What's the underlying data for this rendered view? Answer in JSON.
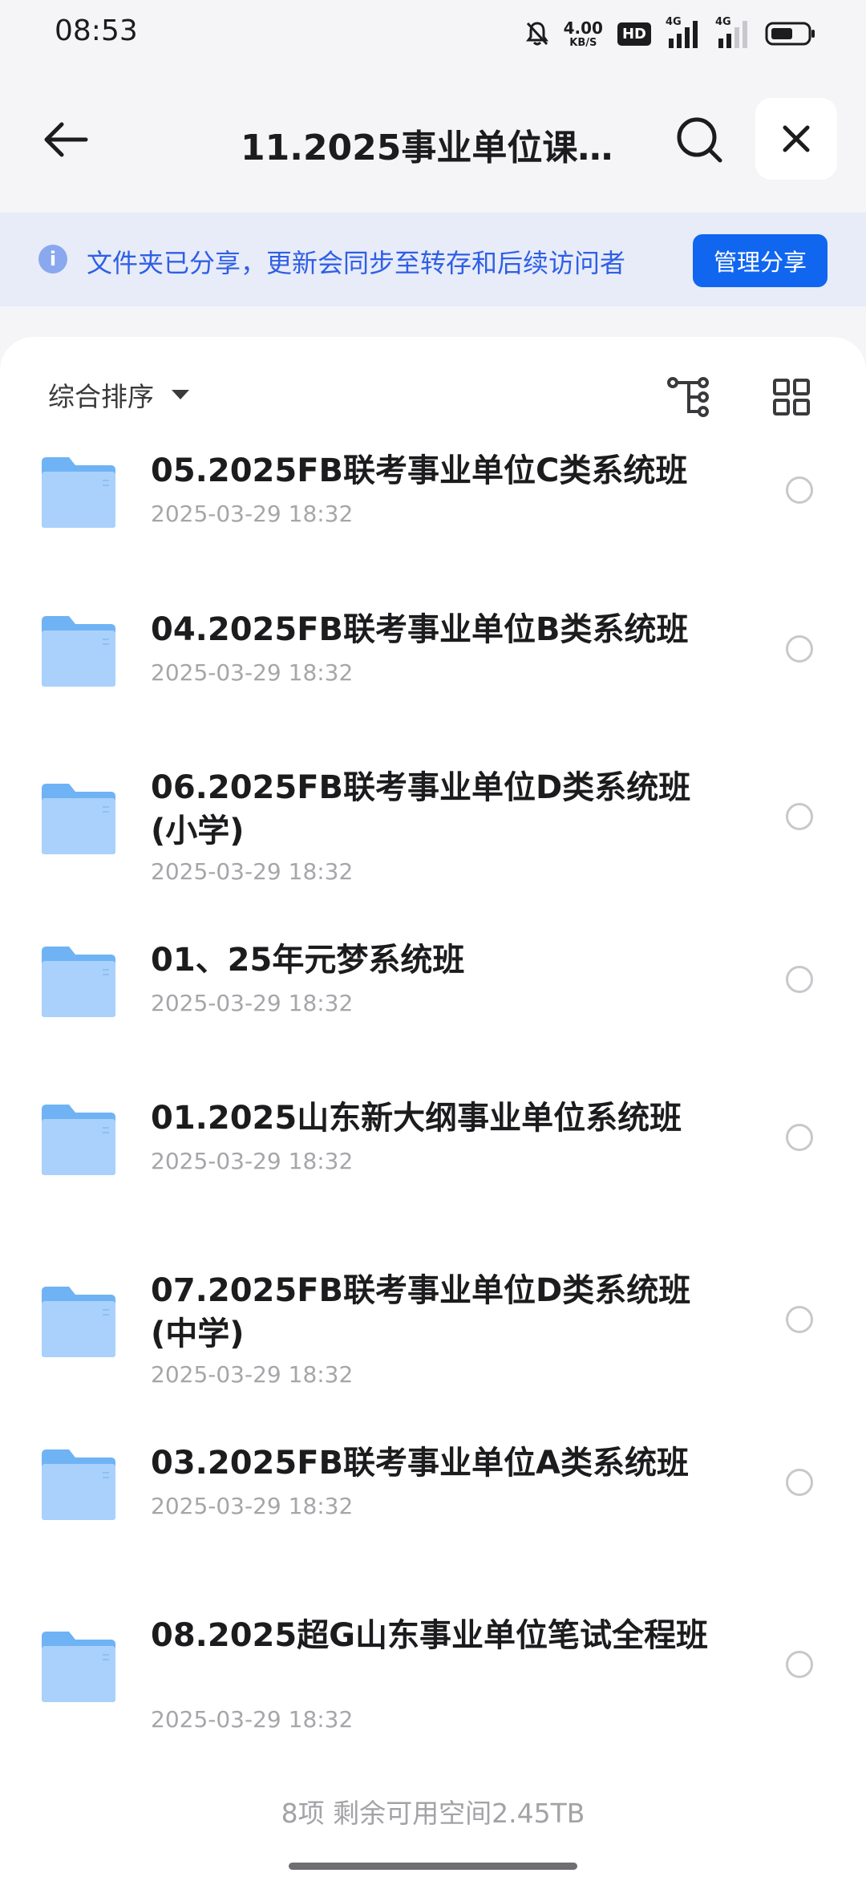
{
  "status_bar": {
    "time": "08:53",
    "net_speed_value": "4.00",
    "net_speed_unit": "KB/S",
    "hd_badge": "HD",
    "signal_1_label": "4G",
    "signal_2_label": "4G",
    "icons": [
      "bell-muted-icon",
      "hd-voice-icon",
      "signal-icon",
      "signal-icon",
      "battery-icon"
    ]
  },
  "header": {
    "title": "11.2025事业单位课…",
    "icons": [
      "back-arrow-icon",
      "search-icon",
      "close-icon"
    ]
  },
  "notice": {
    "icon": "info-icon",
    "icon_glyph": "i",
    "text": "文件夹已分享，更新会同步至转存和后续访问者",
    "button_label": "管理分享"
  },
  "toolbar": {
    "sort_label": "综合排序",
    "icons": [
      "tree-view-icon",
      "grid-view-icon"
    ]
  },
  "files": [
    {
      "name": "05.2025FB联考事业单位C类系统班",
      "date": "2025-03-29 18:32"
    },
    {
      "name": "04.2025FB联考事业单位B类系统班",
      "date": "2025-03-29 18:32"
    },
    {
      "name": "06.2025FB联考事业单位D类系统班(小学)",
      "date": "2025-03-29 18:32"
    },
    {
      "name": "01、25年元梦系统班",
      "date": "2025-03-29 18:32"
    },
    {
      "name": "01.2025山东新大纲事业单位系统班",
      "date": "2025-03-29 18:32"
    },
    {
      "name": "07.2025FB联考事业单位D类系统班(中学)",
      "date": "2025-03-29 18:32"
    },
    {
      "name": "03.2025FB联考事业单位A类系统班",
      "date": "2025-03-29 18:32"
    },
    {
      "name": "08.2025超G山东事业单位笔试全程班",
      "date": "2025-03-29 18:32"
    }
  ],
  "footer": {
    "summary": "8项 剩余可用空间2.45TB"
  },
  "colors": {
    "accent": "#1166f0",
    "notice_bg": "#e8ecf8",
    "notice_text": "#2f5fe6",
    "folder": "#6fb3f5"
  }
}
